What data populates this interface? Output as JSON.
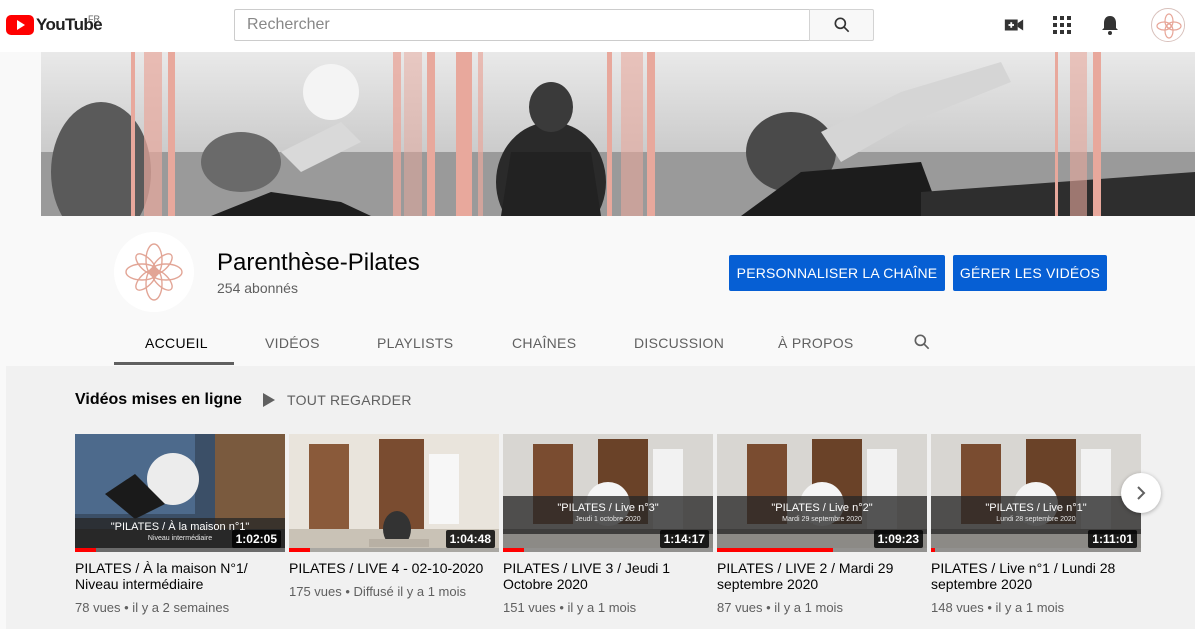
{
  "logo": {
    "text": "YouTube",
    "country": "FR"
  },
  "search": {
    "placeholder": "Rechercher"
  },
  "channel": {
    "name": "Parenthèse-Pilates",
    "subscribers": "254 abonnés",
    "customize_label": "PERSONNALISER LA CHAÎNE",
    "manage_label": "GÉRER LES VIDÉOS"
  },
  "tabs": [
    {
      "label": "ACCUEIL",
      "active": true
    },
    {
      "label": "VIDÉOS"
    },
    {
      "label": "PLAYLISTS"
    },
    {
      "label": "CHAÎNES"
    },
    {
      "label": "DISCUSSION"
    },
    {
      "label": "À PROPOS"
    }
  ],
  "section": {
    "title": "Vidéos mises en ligne",
    "play_all": "TOUT REGARDER"
  },
  "videos": [
    {
      "title": "PILATES / À la maison N°1/ Niveau intermédiaire",
      "duration": "1:02:05",
      "meta": "78 vues • il y a 2 semaines",
      "caption": "\"PILATES / À la maison n°1\"",
      "caption_sub": "Niveau intermédiaire",
      "progress": 0.1
    },
    {
      "title": "PILATES / LIVE 4 - 02-10-2020",
      "duration": "1:04:48",
      "meta": "175 vues • Diffusé il y a 1 mois",
      "caption": "",
      "caption_sub": "",
      "progress": 0.1
    },
    {
      "title": "PILATES / LIVE 3 / Jeudi 1 Octobre 2020",
      "duration": "1:14:17",
      "meta": "151 vues • il y a 1 mois",
      "caption": "\"PILATES / Live n°3\"",
      "caption_sub": "Jeudi 1 octobre 2020",
      "progress": 0.1
    },
    {
      "title": "PILATES / LIVE 2 / Mardi 29 septembre 2020",
      "duration": "1:09:23",
      "meta": "87 vues • il y a 1 mois",
      "caption": "\"PILATES / Live n°2\"",
      "caption_sub": "Mardi 29 septembre 2020",
      "progress": 0.55
    },
    {
      "title": "PILATES / Live n°1 / Lundi 28 septembre 2020",
      "duration": "1:11:01",
      "meta": "148 vues • il y a 1 mois",
      "caption": "\"PILATES / Live n°1\"",
      "caption_sub": "Lundi 28 septembre 2020",
      "progress": 0.02
    }
  ],
  "colors": {
    "accent": "#065fd4",
    "brand": "#ff0000",
    "banner_stripe": "#e8a89c"
  }
}
